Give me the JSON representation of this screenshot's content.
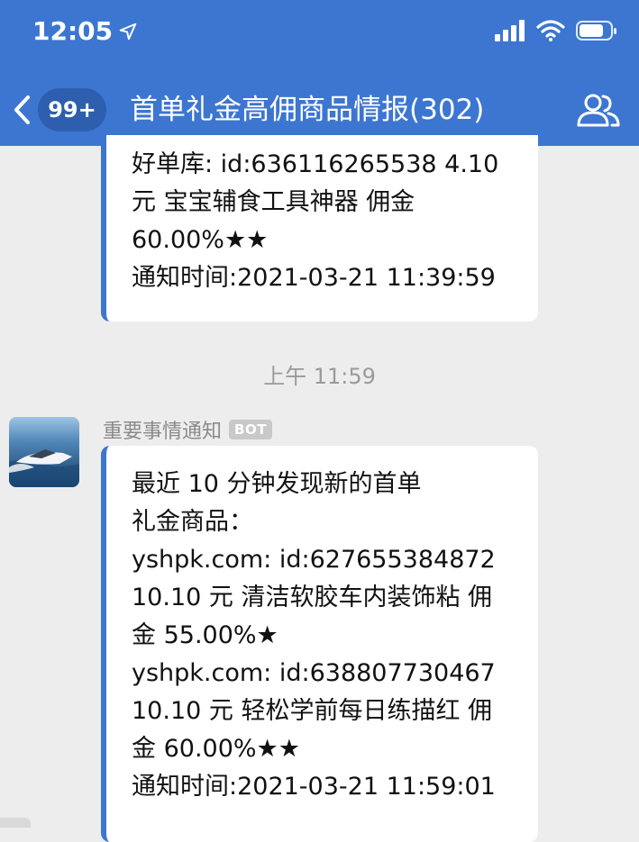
{
  "status_bar": {
    "time": "12:05"
  },
  "header": {
    "unread_badge": "99+",
    "title": "首单礼金高佣商品情报(302)"
  },
  "messages": [
    {
      "lines": [
        "好单库: id:636116265538 4.10",
        "元 宝宝辅食工具神器 佣金",
        "60.00%★★",
        "通知时间:2021-03-21 11:39:59"
      ]
    }
  ],
  "time_divider": "上午 11:59",
  "latest_message": {
    "sender": "重要事情通知",
    "sender_tag": "BOT",
    "lines": [
      "最近 10 分钟发现新的首单",
      "礼金商品：",
      "yshpk.com: id:627655384872",
      "10.10 元 清洁软胶车内装饰粘 佣",
      "金 55.00%★",
      "yshpk.com: id:638807730467",
      "10.10 元 轻松学前每日练描红 佣",
      "金 60.00%★★",
      "通知时间:2021-03-21 11:59:01"
    ]
  }
}
